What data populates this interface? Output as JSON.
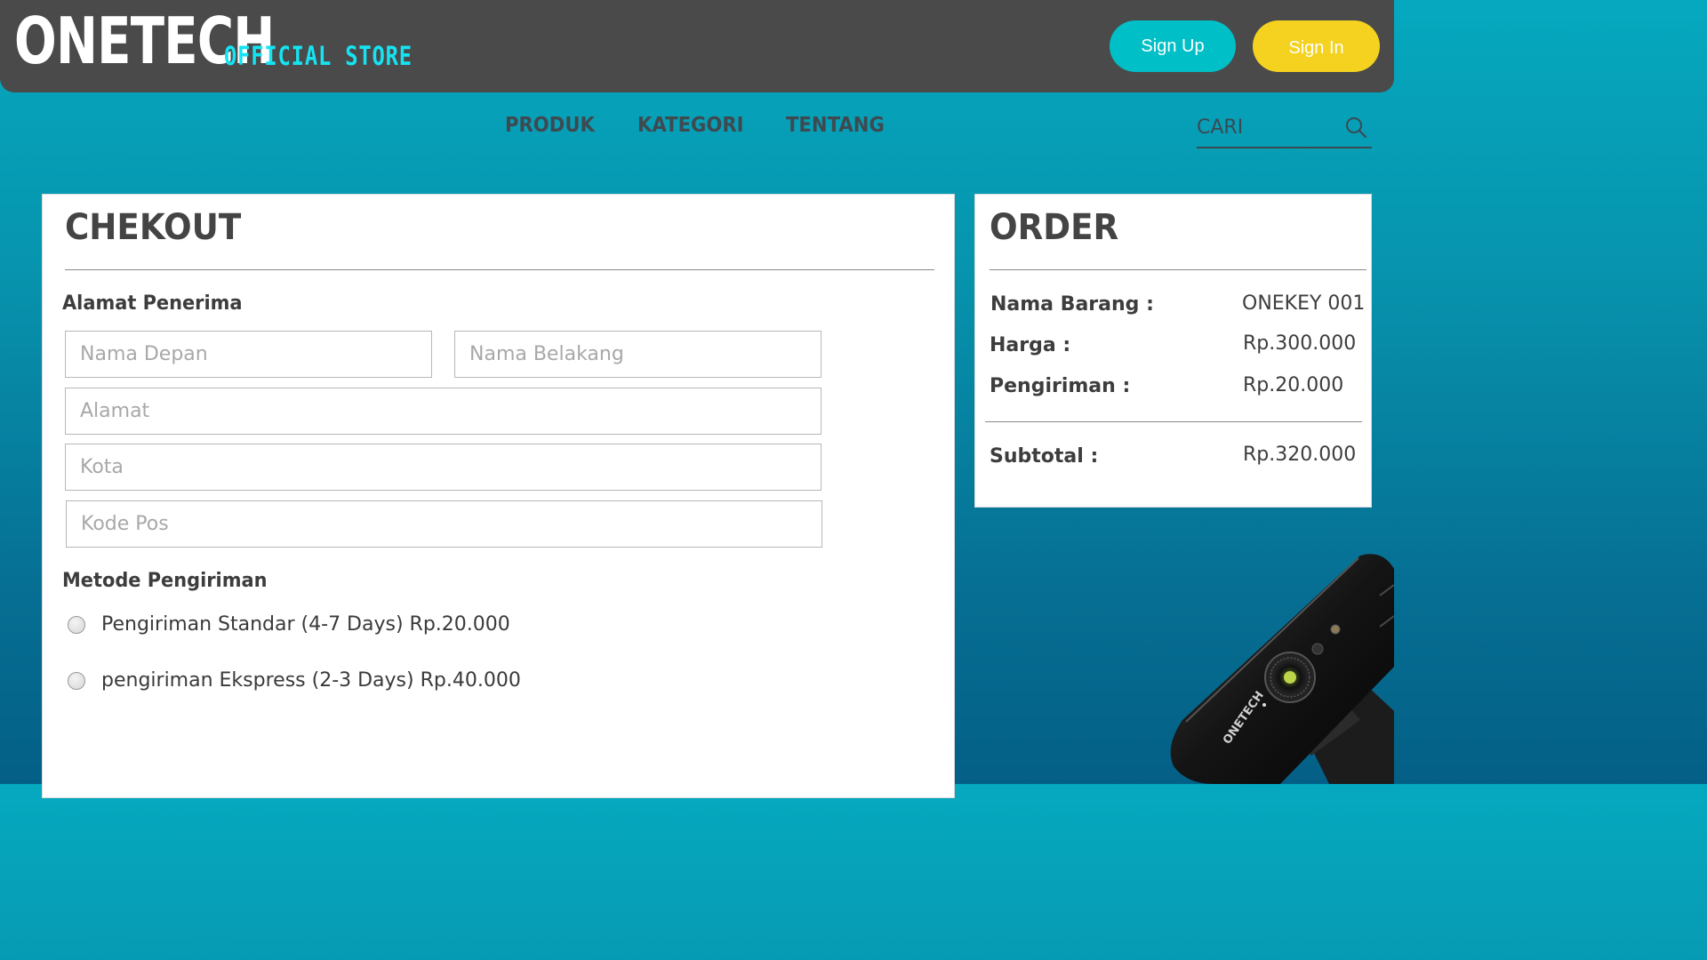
{
  "header": {
    "logo_main": "ONETECH",
    "logo_sub": "OFFICIAL STORE",
    "signup_label": "Sign Up",
    "signin_label": "Sign In"
  },
  "nav": {
    "items": [
      {
        "label": "PRODUK"
      },
      {
        "label": "KATEGORI"
      },
      {
        "label": "TENTANG"
      }
    ],
    "search_placeholder": "CARI",
    "search_icon": "search-icon"
  },
  "checkout": {
    "title": "CHEKOUT",
    "address_section": "Alamat Penerima",
    "fields": {
      "first_name": {
        "placeholder": "Nama Depan",
        "value": ""
      },
      "last_name": {
        "placeholder": "Nama Belakang",
        "value": ""
      },
      "address": {
        "placeholder": "Alamat",
        "value": ""
      },
      "city": {
        "placeholder": "Kota",
        "value": ""
      },
      "postal_code": {
        "placeholder": "Kode Pos",
        "value": ""
      }
    },
    "shipping_section": "Metode Pengiriman",
    "shipping_options": [
      {
        "label": "Pengiriman Standar (4-7 Days) Rp.20.000",
        "selected": false
      },
      {
        "label": "pengiriman Ekspress (2-3 Days) Rp.40.000",
        "selected": false
      }
    ]
  },
  "order": {
    "title": "ORDER",
    "item_name_label": "Nama Barang :",
    "item_name_value": "ONEKEY 001",
    "price_label": "Harga :",
    "price_value": "Rp.300.000",
    "shipping_label": "Pengiriman :",
    "shipping_value": "Rp.20.000",
    "subtotal_label": "Subtotal :",
    "subtotal_value": "Rp.320.000"
  },
  "product_image": {
    "brand_text": "ONETECH"
  },
  "colors": {
    "header_bg": "#4a4a4a",
    "brand_cyan": "#16e3f2",
    "signup": "#00bfc6",
    "signin": "#f4d21f",
    "page_gradient_top": "#05a9bf",
    "page_gradient_bottom": "#045f86"
  }
}
